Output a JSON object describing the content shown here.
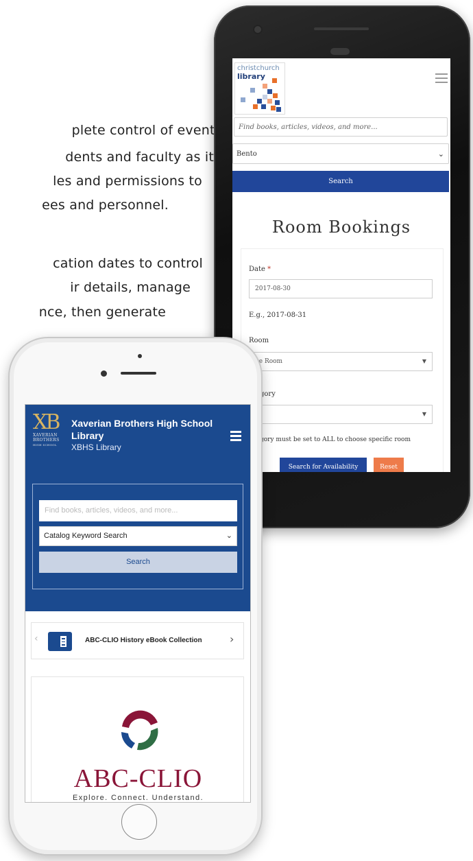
{
  "background_text": {
    "lines": [
      "plete control of events.",
      "dents and faculty as it",
      "les and permissions to",
      "ees and personnel.",
      "cation dates to control",
      "ir details, manage",
      "nce, then generate"
    ]
  },
  "christchurch": {
    "logo_line1": "christchurch",
    "logo_line2": "library",
    "search_placeholder": "Find books, articles, videos, and more...",
    "search_select": "Bento",
    "search_button": "Search",
    "page_title": "Room Bookings",
    "form": {
      "date_label": "Date",
      "required_mark": "*",
      "date_value": "2017-08-30",
      "date_hint": "E.g., 2017-08-31",
      "room_label": "Room",
      "room_value": "ge Room",
      "category_label": "gory",
      "category_value": "",
      "category_note": "gory must be set to ALL to choose specific room",
      "availability_button": "Search for Availability",
      "reset_button": "Reset"
    },
    "colors": {
      "primary": "#21469a",
      "reset": "#ee7b4a"
    }
  },
  "xaverian": {
    "logo_mark": "XB",
    "logo_small": [
      "XAVERIAN",
      "BROTHERS",
      "HIGH SCHOOL"
    ],
    "title_line1": "Xaverian Brothers High School",
    "title_line2": "Library",
    "subtitle": "XBHS Library",
    "search_placeholder": "Find books, articles, videos, and more...",
    "search_select": "Catalog Keyword Search",
    "search_button": "Search",
    "carousel_item": "ABC-CLIO History eBook Collection",
    "card_brand": "ABC-CLIO",
    "card_tagline": "Explore. Connect. Understand.",
    "colors": {
      "header": "#1b4a8f",
      "brand": "#8a1538"
    }
  }
}
